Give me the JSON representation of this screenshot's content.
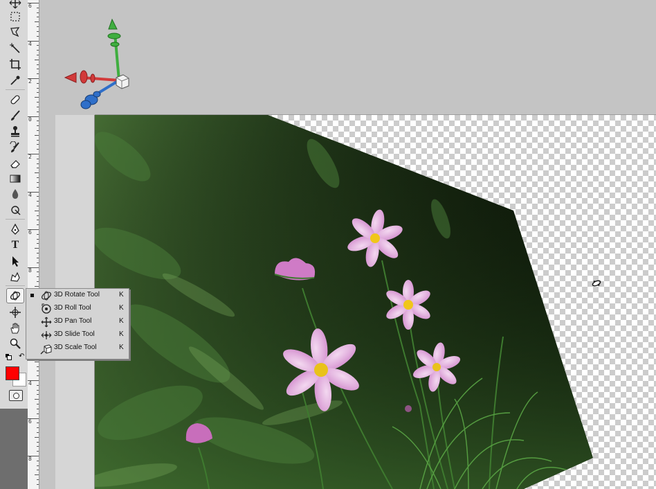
{
  "toolbar": {
    "tools": [
      {
        "name": "move-tool",
        "icon": "move-icon"
      },
      {
        "name": "marquee-tool",
        "icon": "rect-marquee-icon"
      },
      {
        "name": "lasso-tool",
        "icon": "lasso-icon"
      },
      {
        "name": "quick-select-tool",
        "icon": "magic-wand-icon"
      },
      {
        "name": "crop-tool",
        "icon": "crop-icon"
      },
      {
        "name": "eyedropper-tool",
        "icon": "eyedropper-icon"
      },
      {
        "name": "healing-brush-tool",
        "icon": "bandage-icon"
      },
      {
        "name": "brush-tool",
        "icon": "brush-icon"
      },
      {
        "name": "clone-stamp-tool",
        "icon": "stamp-icon"
      },
      {
        "name": "history-brush-tool",
        "icon": "history-brush-icon"
      },
      {
        "name": "eraser-tool",
        "icon": "eraser-icon"
      },
      {
        "name": "gradient-tool",
        "icon": "gradient-icon"
      },
      {
        "name": "blur-tool",
        "icon": "drop-icon"
      },
      {
        "name": "dodge-tool",
        "icon": "dodge-icon"
      },
      {
        "name": "pen-tool",
        "icon": "pen-icon"
      },
      {
        "name": "type-tool",
        "icon": "type-icon",
        "label": "T"
      },
      {
        "name": "path-selection-tool",
        "icon": "arrow-icon"
      },
      {
        "name": "custom-shape-tool",
        "icon": "shape-icon"
      },
      {
        "name": "3d-rotate-tool",
        "icon": "3d-rotate-icon"
      },
      {
        "name": "3d-orbit-tool",
        "icon": "3d-orbit-icon"
      },
      {
        "name": "hand-tool",
        "icon": "hand-icon"
      },
      {
        "name": "zoom-tool",
        "icon": "zoom-icon"
      }
    ],
    "foreground_color": "#ff0000",
    "background_color": "#ffffff"
  },
  "ruler": {
    "labels": [
      "6",
      "4",
      "2",
      "0",
      "2",
      "4",
      "6",
      "8",
      "0",
      "2",
      "4",
      "6",
      "8"
    ]
  },
  "flyout": {
    "items": [
      {
        "label": "3D Rotate Tool",
        "shortcut": "K",
        "selected": true,
        "icon": "3d-rotate-icon"
      },
      {
        "label": "3D Roll Tool",
        "shortcut": "K",
        "selected": false,
        "icon": "3d-roll-icon"
      },
      {
        "label": "3D Pan Tool",
        "shortcut": "K",
        "selected": false,
        "icon": "3d-pan-icon"
      },
      {
        "label": "3D Slide Tool",
        "shortcut": "K",
        "selected": false,
        "icon": "3d-slide-icon"
      },
      {
        "label": "3D Scale Tool",
        "shortcut": "K",
        "selected": false,
        "icon": "3d-scale-icon"
      }
    ]
  },
  "gizmo": {
    "axes": [
      {
        "name": "y-axis",
        "color": "#3fae3f"
      },
      {
        "name": "x-axis",
        "color": "#d23a3a"
      },
      {
        "name": "z-axis",
        "color": "#2f6fc9"
      }
    ]
  }
}
